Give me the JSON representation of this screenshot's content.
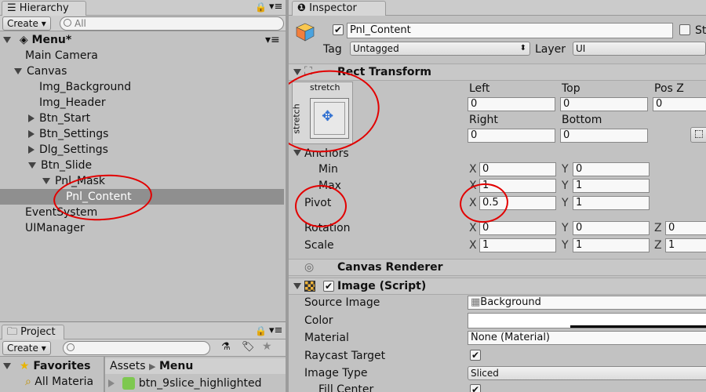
{
  "hierarchy": {
    "tab_label": "Hierarchy",
    "create_label": "Create",
    "search_placeholder": "All",
    "scene_name": "Menu*",
    "items": [
      {
        "label": "Main Camera"
      },
      {
        "label": "Canvas"
      },
      {
        "label": "Img_Background"
      },
      {
        "label": "Img_Header"
      },
      {
        "label": "Btn_Start"
      },
      {
        "label": "Btn_Settings"
      },
      {
        "label": "Dlg_Settings"
      },
      {
        "label": "Btn_Slide"
      },
      {
        "label": "Pnl_Mask"
      },
      {
        "label": "Pnl_Content"
      },
      {
        "label": "EventSystem"
      },
      {
        "label": "UIManager"
      }
    ]
  },
  "project": {
    "tab_label": "Project",
    "create_label": "Create",
    "favorites_label": "Favorites",
    "all_materials_label": "All Materia",
    "breadcrumb_root": "Assets",
    "breadcrumb_current": "Menu",
    "asset_item": "btn_9slice_highlighted"
  },
  "inspector": {
    "tab_label": "Inspector",
    "object_name": "Pnl_Content",
    "static_label": "St",
    "tag_label": "Tag",
    "tag_value": "Untagged",
    "layer_label": "Layer",
    "layer_value": "UI",
    "rect_transform": {
      "title": "Rect Transform",
      "anchor_preset_top": "stretch",
      "anchor_preset_side": "stretch",
      "left_label": "Left",
      "left_value": "0",
      "top_label": "Top",
      "top_value": "0",
      "posz_label": "Pos Z",
      "posz_value": "0",
      "right_label": "Right",
      "right_value": "0",
      "bottom_label": "Bottom",
      "bottom_value": "0",
      "anchors_label": "Anchors",
      "min_label": "Min",
      "min_x": "0",
      "min_y": "0",
      "max_label": "Max",
      "max_x": "1",
      "max_y": "1",
      "pivot_label": "Pivot",
      "pivot_x": "0.5",
      "pivot_y": "1",
      "rotation_label": "Rotation",
      "rot_x": "0",
      "rot_y": "0",
      "rot_z": "0",
      "scale_label": "Scale",
      "scale_x": "1",
      "scale_y": "1",
      "scale_z": "1",
      "x_axis": "X",
      "y_axis": "Y",
      "z_axis": "Z"
    },
    "canvas_renderer": {
      "title": "Canvas Renderer"
    },
    "image_script": {
      "title": "Image (Script)",
      "source_image_label": "Source Image",
      "source_image_value": "Background",
      "color_label": "Color",
      "material_label": "Material",
      "material_value": "None (Material)",
      "raycast_label": "Raycast Target",
      "image_type_label": "Image Type",
      "image_type_value": "Sliced",
      "fill_center_label": "Fill Center"
    }
  },
  "colors": {
    "annotation_red": "#e20000",
    "selection": "#8f8f8f",
    "panel_bg": "#c2c2c2"
  }
}
